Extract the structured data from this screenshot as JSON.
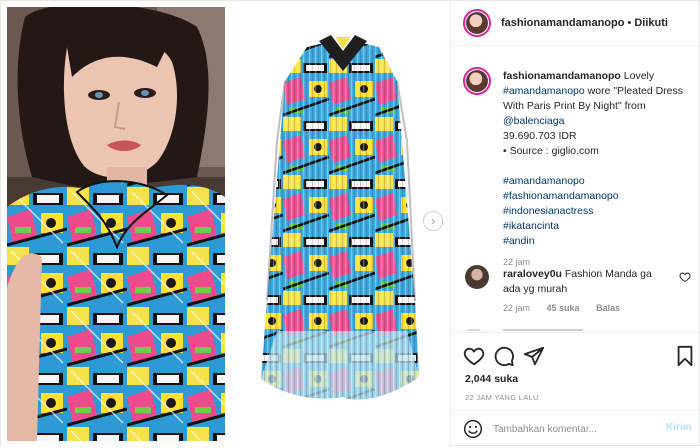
{
  "header": {
    "username": "fashionamandamanopo",
    "separator": "•",
    "follow_label": "Diikuti"
  },
  "caption": {
    "username": "fashionamandamanopo",
    "line1": "Lovely",
    "mention1": "#amandamanopo",
    "line2": "wore \"Pleated Dress With Paris Print By Night\" from",
    "mention2": "@balenciaga",
    "price": "39.690.703 IDR",
    "source": "• Source : giglio.com",
    "tags": [
      "#amandamanopo",
      "#fashionamandamanopo",
      "#indonesianactress",
      "#ikatancinta",
      "#andin"
    ],
    "time": "22 jam"
  },
  "comment": {
    "username": "raraloveу0u",
    "text": "Fashion Manda ga ada yg murah",
    "time": "22 jam",
    "likes": "45 suka",
    "reply_label": "Balas"
  },
  "actions": {
    "likes": "2,044 suka",
    "ago": "22 JAM YANG LALU"
  },
  "add_comment": {
    "placeholder": "Tambahkan komentar...",
    "post_label": "Kirim"
  },
  "icons": {
    "like": "heart-icon",
    "comment": "comment-icon",
    "share": "paper-plane-icon",
    "save": "bookmark-icon",
    "emoji": "smiley-icon",
    "next": "chevron-right-icon"
  },
  "colors": {
    "link": "#00376b",
    "muted": "#8e8e8e",
    "post_button": "#b2dffc",
    "story_ring": "#d6249f"
  }
}
